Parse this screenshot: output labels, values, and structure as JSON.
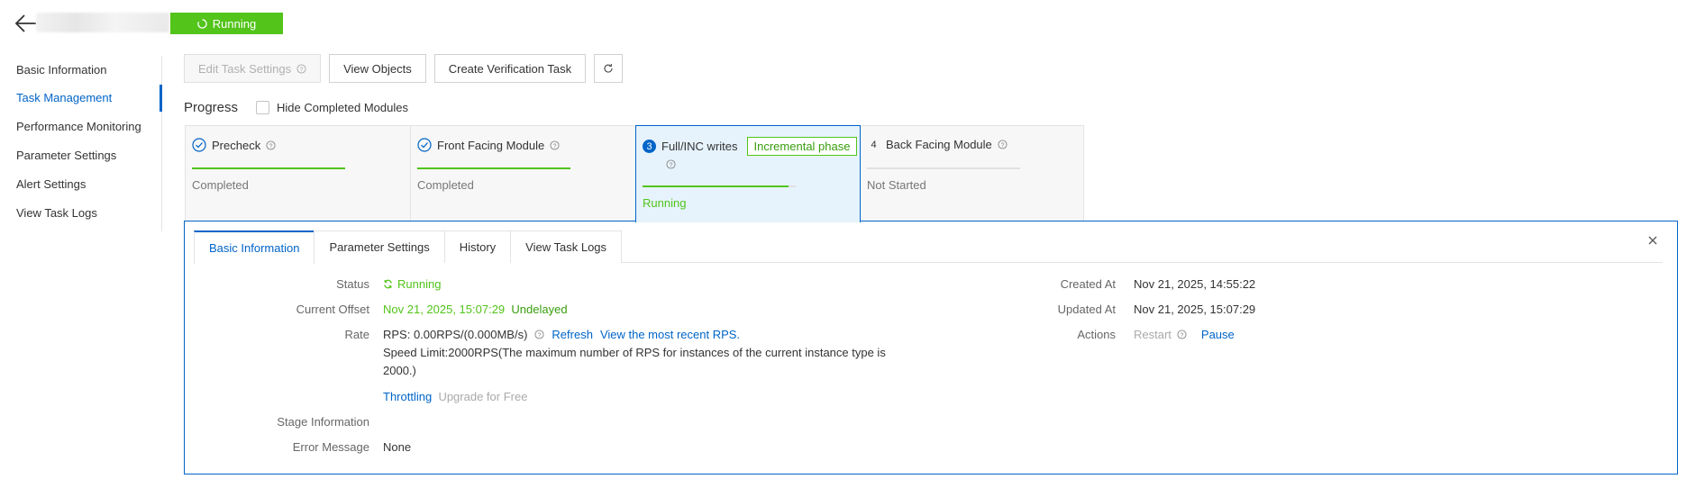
{
  "header": {
    "status": "Running",
    "status_color": "#52c41a"
  },
  "sidebar": {
    "items": [
      {
        "label": "Basic Information"
      },
      {
        "label": "Task Management"
      },
      {
        "label": "Performance Monitoring"
      },
      {
        "label": "Parameter Settings"
      },
      {
        "label": "Alert Settings"
      },
      {
        "label": "View Task Logs"
      }
    ],
    "active_index": 1
  },
  "toolbar": {
    "edit_label": "Edit Task Settings",
    "view_objects_label": "View Objects",
    "create_verification_label": "Create Verification Task",
    "refresh_icon": "refresh-icon"
  },
  "progress": {
    "title": "Progress",
    "hide_completed_label": "Hide Completed Modules",
    "hide_completed_checked": false,
    "steps": [
      {
        "title": "Precheck",
        "status": "Completed",
        "progress": 1.0
      },
      {
        "title": "Front Facing Module",
        "status": "Completed",
        "progress": 1.0
      },
      {
        "number": "3",
        "title": "Full/INC writes",
        "tag": "Incremental phase",
        "status": "Running",
        "progress": 0.95
      },
      {
        "number": "4",
        "title": "Back Facing Module",
        "status": "Not Started",
        "progress": 0
      }
    ]
  },
  "detail": {
    "tabs": [
      "Basic Information",
      "Parameter Settings",
      "History",
      "View Task Logs"
    ],
    "active_tab": 0,
    "labels": {
      "status": "Status",
      "current_offset": "Current Offset",
      "rate": "Rate",
      "stage_information": "Stage Information",
      "error_message": "Error Message",
      "created_at": "Created At",
      "updated_at": "Updated At",
      "actions": "Actions"
    },
    "values": {
      "status": "Running",
      "current_offset_time": "Nov 21, 2025, 15:07:29",
      "current_offset_delay": "Undelayed",
      "rate_rps": "RPS: 0.00RPS/(0.000MB/s)",
      "rate_refresh": "Refresh",
      "rate_recent": "View the most recent RPS.",
      "speed_limit_line1": "Speed Limit:2000RPS(The maximum number of RPS for instances of the current instance type is",
      "speed_limit_line2": "2000.)",
      "throttling": "Throttling",
      "upgrade": "Upgrade for Free",
      "stage_information": "",
      "error_message": "None",
      "created_at": "Nov 21, 2025, 14:55:22",
      "updated_at": "Nov 21, 2025, 15:07:29",
      "action_restart": "Restart",
      "action_pause": "Pause"
    }
  },
  "colors": {
    "accent": "#0064c8",
    "success": "#52c41a"
  }
}
